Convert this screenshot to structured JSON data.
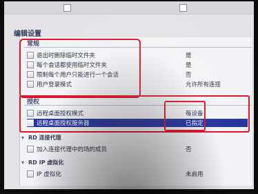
{
  "section_title": "编辑设置",
  "groups": {
    "general": {
      "title": "常规",
      "rows": [
        {
          "label": "退出时删除临时文件夹",
          "value": "是"
        },
        {
          "label": "每个会话都使用临时文件夹",
          "value": "是"
        },
        {
          "label": "限制每个用户只能进行一个会话",
          "value": "否"
        },
        {
          "label": "用户登录模式",
          "value": "允许所有连接"
        }
      ]
    },
    "licensing": {
      "title": "授权",
      "rows": [
        {
          "label": "远程桌面授权模式",
          "value": "每设备"
        },
        {
          "label": "远程桌面授权服务器",
          "value": "已指定"
        }
      ]
    },
    "rd_broker": {
      "title": "RD 连接代理",
      "rows": [
        {
          "label": "加入连接代理中的场的成员",
          "value": "否"
        }
      ]
    },
    "ip_virt": {
      "title": "RD IP 虚拟化",
      "rows": [
        {
          "label": "IP 虚拟化",
          "value": "未启用"
        }
      ]
    }
  },
  "colors": {
    "annotation": "#e0102a",
    "selection": "#24349a"
  }
}
